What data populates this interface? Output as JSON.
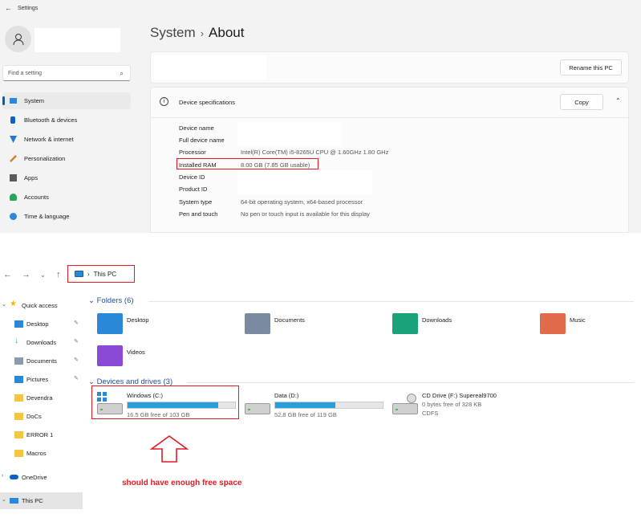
{
  "settings": {
    "window_title": "Settings",
    "search_placeholder": "Find a setting",
    "nav": [
      {
        "label": "System",
        "color": "#2b88d8"
      },
      {
        "label": "Bluetooth & devices",
        "color": "#0a62c9"
      },
      {
        "label": "Network & internet",
        "color": "#1e78d6"
      },
      {
        "label": "Personalization",
        "color": "#d9822b"
      },
      {
        "label": "Apps",
        "color": "#5b5b5b"
      },
      {
        "label": "Accounts",
        "color": "#2aa35a"
      },
      {
        "label": "Time & language",
        "color": "#2b88d8"
      }
    ],
    "breadcrumb_parent": "System",
    "breadcrumb_sep": "›",
    "breadcrumb_current": "About",
    "rename_button": "Rename this PC",
    "specs_title": "Device specifications",
    "copy_button": "Copy",
    "specs": [
      {
        "key": "Device name",
        "value": ""
      },
      {
        "key": "Full device name",
        "value": ""
      },
      {
        "key": "Processor",
        "value": "Intel(R) Core(TM) i5-8265U CPU @ 1.60GHz   1.80 GHz"
      },
      {
        "key": "Installed RAM",
        "value": "8.00 GB (7.85 GB usable)"
      },
      {
        "key": "Device ID",
        "value": ""
      },
      {
        "key": "Product ID",
        "value": ""
      },
      {
        "key": "System type",
        "value": "64-bit operating system, x64-based processor"
      },
      {
        "key": "Pen and touch",
        "value": "No pen or touch input is available for this display"
      }
    ]
  },
  "explorer": {
    "address": "This PC",
    "address_sep": "›",
    "sidebar": [
      {
        "label": "Quick access",
        "pinned": false
      },
      {
        "label": "Desktop",
        "pinned": true
      },
      {
        "label": "Downloads",
        "pinned": true
      },
      {
        "label": "Documents",
        "pinned": true
      },
      {
        "label": "Pictures",
        "pinned": true
      },
      {
        "label": "Devendra",
        "pinned": false
      },
      {
        "label": "DoCs",
        "pinned": false
      },
      {
        "label": "ERROR 1",
        "pinned": false
      },
      {
        "label": "Macros",
        "pinned": false
      },
      {
        "label": "OneDrive",
        "pinned": false
      },
      {
        "label": "This PC",
        "pinned": false
      }
    ],
    "folders_header": "Folders (6)",
    "folders": [
      {
        "label": "Desktop",
        "color": "#2b88d8"
      },
      {
        "label": "Documents",
        "color": "#7a8aa0"
      },
      {
        "label": "Downloads",
        "color": "#1aa37a"
      },
      {
        "label": "Music",
        "color": "#e06a4a"
      },
      {
        "label": "Videos",
        "color": "#8a4ad6"
      }
    ],
    "drives_header": "Devices and drives (3)",
    "drives": [
      {
        "name": "Windows (C:)",
        "free": "16.5 GB free of 103 GB",
        "used_fraction": 0.84
      },
      {
        "name": "Data (D:)",
        "free": "52.8 GB free of 119 GB",
        "used_fraction": 0.56
      },
      {
        "name": "CD Drive (F:) Supereal9700",
        "free": "0 bytes free of 328 KB",
        "fs": "CDFS"
      }
    ],
    "annotation": "should have enough free space"
  }
}
